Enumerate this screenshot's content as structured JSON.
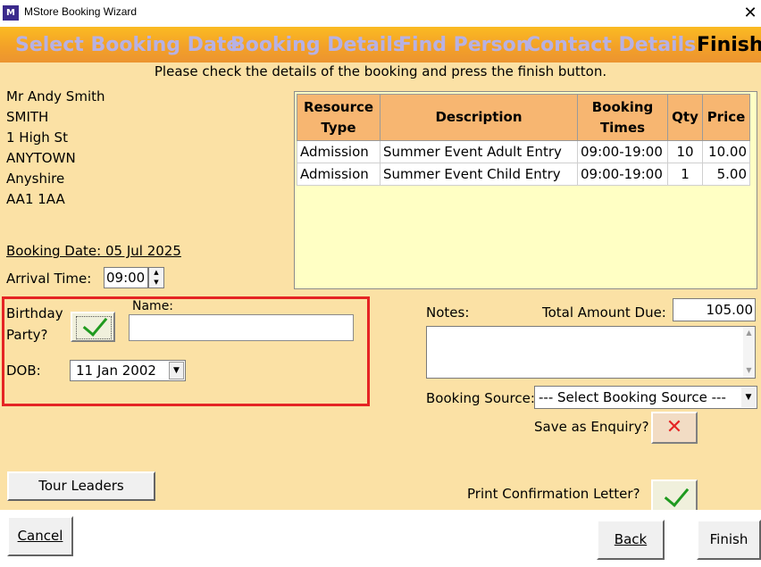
{
  "window": {
    "icon_text": "M",
    "title": "MStore Booking Wizard",
    "close_glyph": "✕"
  },
  "steps": [
    "Select Booking Date",
    "Booking Details",
    "Find Person",
    "Contact Details",
    "Finish"
  ],
  "instruction": "Please check the details of the booking and press the finish button.",
  "address": [
    "Mr Andy Smith",
    "SMITH",
    "1 High St",
    "ANYTOWN",
    "Anyshire",
    "AA1 1AA"
  ],
  "booking_date": "Booking Date: 05 Jul 2025",
  "arrival": {
    "label": "Arrival Time:",
    "value": "09:00"
  },
  "grid": {
    "headers": [
      "Resource Type",
      "Description",
      "Booking Times",
      "Qty",
      "Price"
    ],
    "rows": [
      [
        "Admission",
        "Summer Event Adult Entry",
        "09:00-19:00",
        "10",
        "10.00"
      ],
      [
        "Admission",
        "Summer Event Child Entry",
        "09:00-19:00",
        "1",
        "5.00"
      ]
    ]
  },
  "birthday": {
    "label_line1": "Birthday",
    "label_line2": "Party?",
    "checked": true,
    "name_label": "Name:",
    "name_value": "",
    "dob_label": "DOB:",
    "dob_value": "11  Jan  2002"
  },
  "notes": {
    "label": "Notes:",
    "value": ""
  },
  "total": {
    "label": "Total Amount Due:",
    "value": "105.00"
  },
  "booking_source": {
    "label": "Booking Source:",
    "selected": "--- Select Booking Source ---"
  },
  "enquiry": {
    "label": "Save as Enquiry?",
    "glyph": "✕"
  },
  "print_letter": {
    "label": "Print Confirmation Letter?",
    "checked": true
  },
  "buttons": {
    "tour_leaders": "Tour Leaders",
    "cancel": "Cancel",
    "back": "Back",
    "finish": "Finish"
  },
  "colors": {
    "step_inactive": "#b7b1e4",
    "background": "#fbe1a5",
    "grid_header": "#f7b671",
    "highlight_frame": "#e52424"
  }
}
